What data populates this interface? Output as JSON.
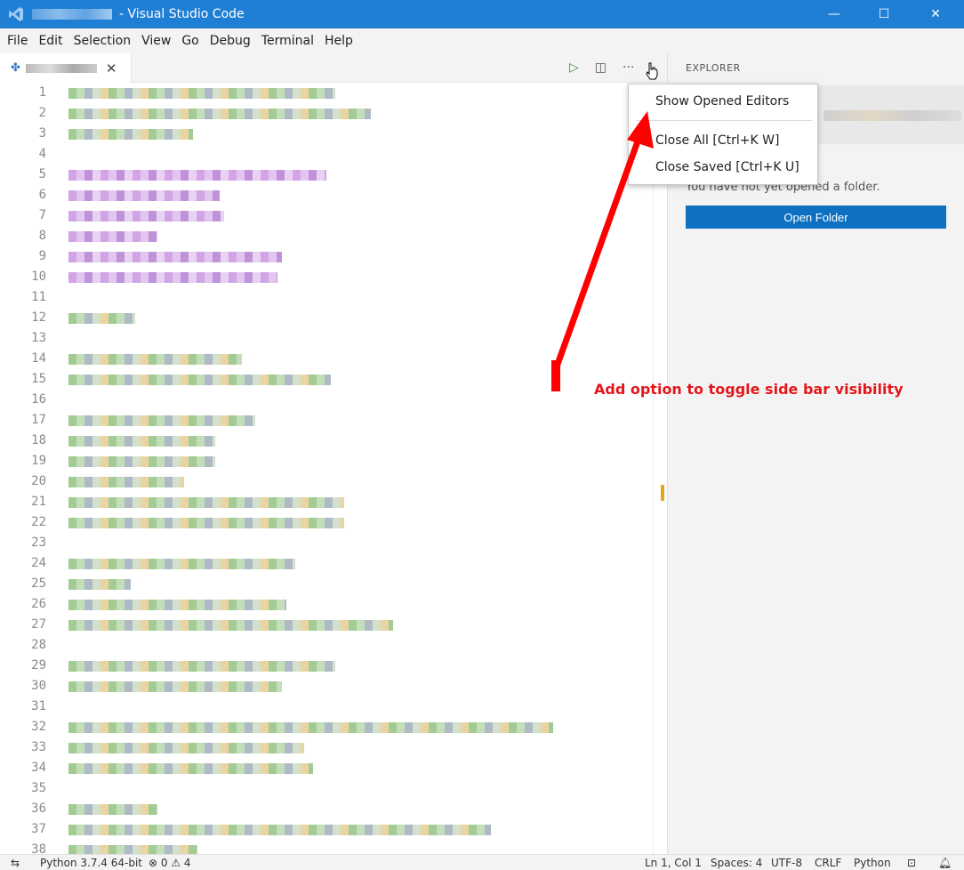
{
  "window": {
    "title": "- Visual Studio Code",
    "controls": {
      "minimize": "—",
      "maximize": "☐",
      "close": "✕"
    }
  },
  "menu": [
    "File",
    "Edit",
    "Selection",
    "View",
    "Go",
    "Debug",
    "Terminal",
    "Help"
  ],
  "tab": {
    "close": "✕"
  },
  "editor_actions": {
    "run": "▷",
    "split": "◫",
    "more": "···"
  },
  "line_numbers": [
    "1",
    "2",
    "3",
    "4",
    "5",
    "6",
    "7",
    "8",
    "9",
    "10",
    "11",
    "12",
    "13",
    "14",
    "15",
    "16",
    "17",
    "18",
    "19",
    "20",
    "21",
    "22",
    "23",
    "24",
    "25",
    "26",
    "27",
    "28",
    "29",
    "30",
    "31",
    "32",
    "33",
    "34",
    "35",
    "36",
    "37",
    "38"
  ],
  "context_menu": {
    "items": [
      "Show Opened Editors",
      "Close All [Ctrl+K W]",
      "Close Saved [Ctrl+K U]"
    ]
  },
  "sidebar": {
    "header": "EXPLORER",
    "message": "You have not yet opened a folder.",
    "open_folder": "Open Folder"
  },
  "annotation": {
    "text": "Add option to toggle side bar visibility",
    "color": "#e3161a"
  },
  "status": {
    "python": "Python 3.7.4 64-bit",
    "problems": "⊗ 0 ⚠ 4",
    "position": "Ln 1, Col 1",
    "spaces": "Spaces: 4",
    "encoding": "UTF-8",
    "eol": "CRLF",
    "language": "Python"
  },
  "colors": {
    "titlebar": "#1f7fd4",
    "accent": "#0e70c0",
    "scroll_marker": "#e8a317"
  }
}
